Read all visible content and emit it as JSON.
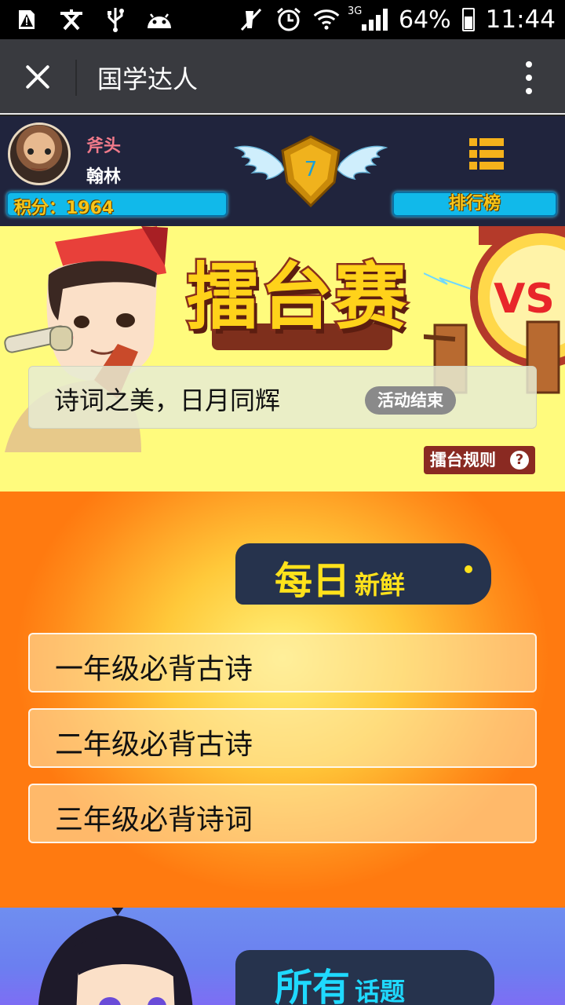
{
  "status_bar": {
    "battery": "64%",
    "time": "11:44",
    "network": "3G",
    "icons": [
      "warning-icon",
      "text-input-icon",
      "usb-icon",
      "android-icon",
      "mute-icon",
      "alarm-icon",
      "wifi-icon",
      "signal-icon",
      "battery-icon"
    ]
  },
  "app_bar": {
    "title": "国学达人"
  },
  "header": {
    "nickname": "斧头",
    "rank_title": "翰林",
    "score_label": "积分：1964",
    "level": "7",
    "leaderboard_label": "排行榜"
  },
  "arena": {
    "title": "擂台赛",
    "vs_text": "VS",
    "event_name": "诗词之美，日月同辉",
    "event_status": "活动结束",
    "rules_label": "擂台规则"
  },
  "daily": {
    "heading_big": "每日",
    "heading_small": "新鲜",
    "topics": [
      {
        "label": "一年级必背古诗"
      },
      {
        "label": "二年级必背古诗"
      },
      {
        "label": "三年级必背诗词"
      }
    ]
  },
  "all_topics": {
    "heading_big": "所有",
    "heading_small": "话题"
  },
  "colors": {
    "header_bg": "#20243d",
    "accent_blue": "#11b9ea",
    "gold": "#f7c51a",
    "arena_bg": "#fffb7d",
    "daily_orange": "#ff8c1a",
    "all_blue": "#6f8ef0"
  }
}
